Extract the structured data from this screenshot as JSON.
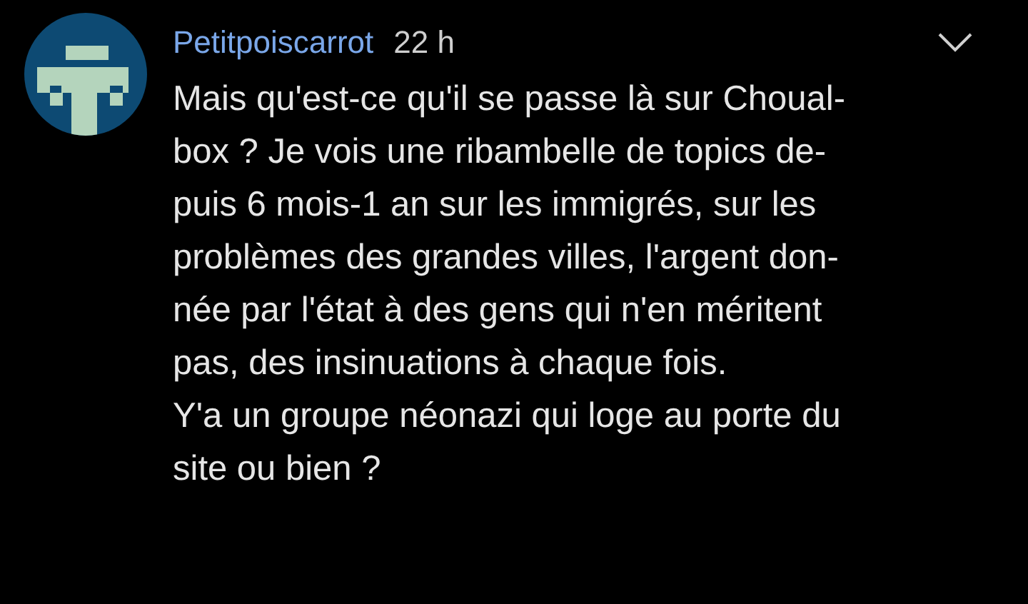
{
  "comment": {
    "author": "Petitpoiscarrot",
    "time": "22 h",
    "lines": [
      "Mais qu'est-ce qu'il se passe là sur Choual-",
      "box ? Je vois une ribambelle de topics de-",
      "puis 6 mois-1 an sur les immigrés, sur les",
      "problèmes des grandes villes, l'argent don-",
      "née par l'état à des gens qui n'en méritent",
      "pas, des insinuations à chaque fois.",
      "Y'a un groupe néonazi qui loge au porte du",
      "site ou bien ?"
    ]
  }
}
